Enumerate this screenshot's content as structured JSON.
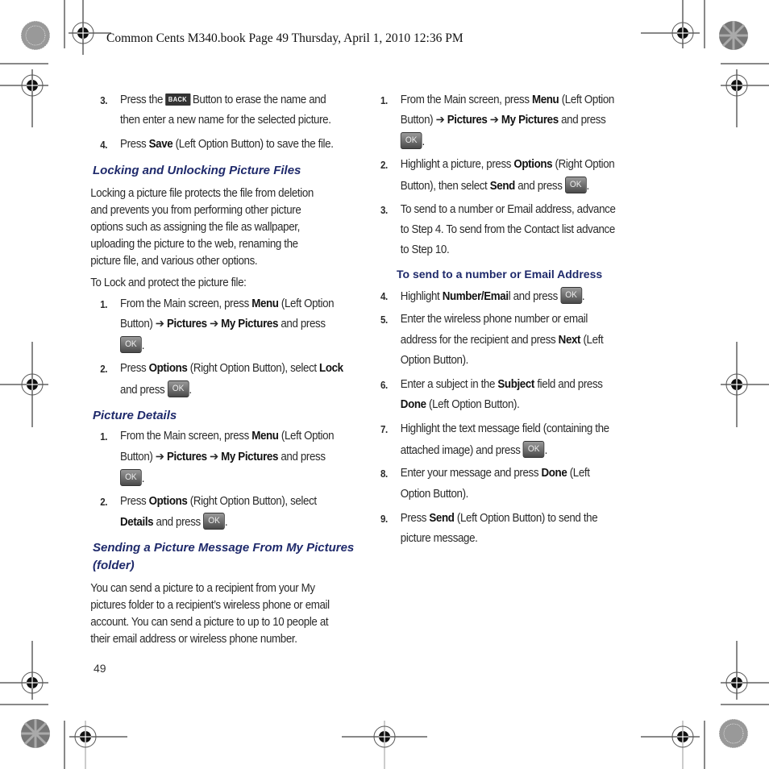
{
  "header": {
    "text": "Common Cents M340.book  Page 49  Thursday, April 1, 2010  12:36 PM"
  },
  "left": {
    "step3": {
      "num": "3.",
      "a": "Press the",
      "btn": "BACK",
      "b": "Button to erase the name and",
      "c": "then enter a new name for the selected picture."
    },
    "step4": {
      "num": "4.",
      "a": "Press ",
      "bold": "Save",
      "b": " (Left Option Button) to save the file."
    },
    "heading_locking": "Locking and Unlocking Picture Files",
    "locking_para": [
      "Locking a picture file protects the file from deletion",
      "and prevents you from performing other picture",
      "options such as assigning the file as wallpaper,",
      "uploading the picture to the web, renaming the",
      "picture file, and various other options."
    ],
    "lock_intro": "To Lock and protect the picture file:",
    "lock_steps": [
      {
        "num": "1.",
        "l1a": "From the Main screen, press ",
        "l1b": "Menu",
        "l1c": " (Left Option",
        "l2a": "Button) ➔ ",
        "l2b": "Pictures",
        "l2c": "  ➔ ",
        "l2d": "My Pictures",
        "l2e": " and press",
        "ok": "OK"
      },
      {
        "num": "2.",
        "l1a": "Press ",
        "l1b": "Options",
        "l1c": " (Right Option Button), select ",
        "l1d": "Lock",
        "l2a": "and press",
        "ok": "OK"
      }
    ],
    "heading_details": "Picture Details",
    "details_steps": [
      {
        "num": "1.",
        "l1a": "From the Main screen, press ",
        "l1b": "Menu",
        "l1c": " (Left Option",
        "l2a": "Button) ➔ ",
        "l2b": "Pictures",
        "l2c": "  ➔ ",
        "l2d": "My Pictures",
        "l2e": " and press",
        "ok": "OK"
      },
      {
        "num": "2.",
        "l1a": "Press ",
        "l1b": "Options",
        "l1c": " (Right Option Button), select",
        "l2a": "Details",
        "l2b": " and press",
        "ok": "OK"
      }
    ],
    "heading_sending": [
      "Sending a Picture Message From My Pictures",
      "(folder)"
    ],
    "sending_para": [
      "You can send a picture to a recipient from your My",
      "pictures folder to a recipient’s wireless phone or email",
      "account. You can send a picture to up to 10 people at",
      "their email address or wireless phone number."
    ],
    "page_number": "49"
  },
  "right": {
    "steps": [
      {
        "num": "1.",
        "l1a": "From the Main screen, press ",
        "l1b": "Menu",
        "l1c": " (Left Option",
        "l2a": "Button) ➔ ",
        "l2b": "Pictures",
        "l2c": "  ➔ ",
        "l2d": "My Pictures",
        "l2e": " and press",
        "ok": "OK"
      },
      {
        "num": "2.",
        "l1a": "Highlight a picture, press ",
        "l1b": "Options",
        "l1c": " (Right Option",
        "l2a": "Button), then select ",
        "l2b": "Send",
        "l2c": " and press",
        "ok": "OK"
      },
      {
        "num": "3.",
        "l1": "To send to a number or Email address, advance",
        "l2": "to Step 4. To send from the Contact list advance",
        "l3": "to Step 10."
      }
    ],
    "subheading": "To send to a number or Email Address",
    "steps2": [
      {
        "num": "4.",
        "a": "Highlight ",
        "b": "Number/Emai",
        "c": "l and press",
        "ok": "OK"
      },
      {
        "num": "5.",
        "l1": "Enter the wireless phone number or email",
        "l2a": "address for the recipient and press ",
        "l2b": "Next",
        "l2c": " (Left",
        "l3": "Option Button)."
      },
      {
        "num": "6.",
        "l1a": "Enter a subject in the ",
        "l1b": "Subject",
        "l1c": " field and press",
        "l2a": "Done",
        "l2b": " (Left Option Button)."
      },
      {
        "num": "7.",
        "l1": "Highlight the text message field (containing the",
        "l2": "attached image) and press",
        "ok": "OK"
      },
      {
        "num": "8.",
        "l1a": "Enter your message and press ",
        "l1b": "Done",
        "l1c": " (Left",
        "l2": "Option Button)."
      },
      {
        "num": "9.",
        "l1a": "Press ",
        "l1b": "Send",
        "l1c": " (Left Option Button) to send the",
        "l2": "picture message."
      }
    ]
  }
}
